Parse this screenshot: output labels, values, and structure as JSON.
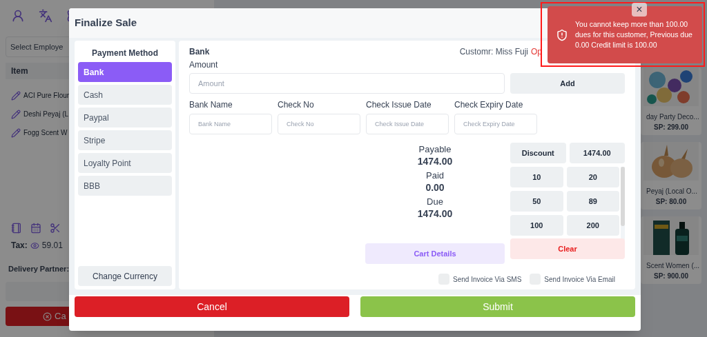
{
  "background": {
    "employee_select": {
      "placeholder": "Select Employe"
    },
    "cart": {
      "column": "Item",
      "items": [
        "ACI Pure Flour",
        "Deshi Peyaj (L",
        "Fogg Scent W"
      ]
    },
    "tax": {
      "label": "Tax:",
      "value": "59.01"
    },
    "delivery_partner": "Delivery Partner:",
    "cancel_button": "Ca",
    "products": [
      {
        "name": "day Party Deco...",
        "price": "SP: 299.00"
      },
      {
        "name": "Peyaj (Local O...",
        "price": "SP: 80.00"
      },
      {
        "name": "Scent Women (...",
        "price": "SP: 900.00"
      }
    ]
  },
  "modal": {
    "title": "Finalize Sale",
    "payment_method_title": "Payment Method",
    "payment_methods": [
      {
        "label": "Bank",
        "selected": true
      },
      {
        "label": "Cash",
        "selected": false
      },
      {
        "label": "Paypal",
        "selected": false
      },
      {
        "label": "Stripe",
        "selected": false
      },
      {
        "label": "Loyalty Point",
        "selected": false
      },
      {
        "label": "BBB",
        "selected": false
      }
    ],
    "change_currency": "Change Currency",
    "method_title": "Bank",
    "customer": "Customr: Miss Fuji",
    "opening": "Op",
    "amount": {
      "label": "Amount",
      "placeholder": "Amount"
    },
    "add_button": "Add",
    "bank_fields": [
      {
        "label": "Bank Name",
        "placeholder": "Bank Name"
      },
      {
        "label": "Check No",
        "placeholder": "Check No"
      },
      {
        "label": "Check Issue Date",
        "placeholder": "Check Issue Date"
      },
      {
        "label": "Check Expiry Date",
        "placeholder": "Check Expiry Date"
      }
    ],
    "summary": [
      {
        "label": "Payable",
        "value": "1474.00"
      },
      {
        "label": "Paid",
        "value": "0.00"
      },
      {
        "label": "Due",
        "value": "1474.00"
      }
    ],
    "discount": {
      "label": "Discount",
      "value": "1474.00"
    },
    "quick_amounts": [
      "10",
      "20",
      "50",
      "89",
      "100",
      "200"
    ],
    "cart_details_button": "Cart Details",
    "clear_button": "Clear",
    "send_options": [
      {
        "label": "Send Invoice Via SMS",
        "checked": false
      },
      {
        "label": "Send Invoice Via Email",
        "checked": false
      }
    ],
    "cancel_button": "Cancel",
    "submit_button": "Submit"
  },
  "toast": {
    "message": "You cannot keep more than 100.00 dues for this customer, Previous due 0.00 Credit limit is 100.00",
    "close": "×"
  }
}
